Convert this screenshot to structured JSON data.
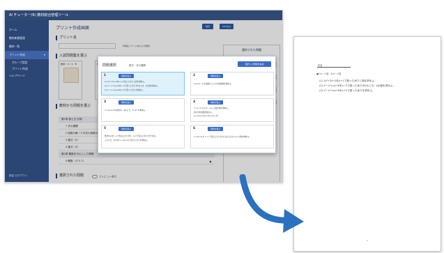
{
  "app": {
    "title": "Al チューター(R) 教材総合管理ツール",
    "sidebar": {
      "items": [
        {
          "label": "ホーム"
        },
        {
          "label": "教材新着管理"
        },
        {
          "label": "教材一覧"
        },
        {
          "label": "プリント作成",
          "active": true
        },
        {
          "label": "プリント管理"
        },
        {
          "label": "ヘルプページ"
        }
      ],
      "subitems": [
        {
          "label": "グループ設定"
        },
        {
          "label": "プリント作成"
        }
      ],
      "footer": "設定  ログアウト"
    },
    "main": {
      "title": "プリント作成画面",
      "header_buttons": [
        "保存",
        "PDF出力"
      ],
      "sections": {
        "print_name": "プリント名",
        "print_name_hint": "印刷名 1ページあたりの問題",
        "textbook": "入試問題集を選ぶ",
        "source_select": "教材から問題を選ぶ",
        "selected": "選択された問題"
      },
      "thumbnails": [
        {
          "label": "数学Ⅰ・Ａ・Ⅱ・Ｂ"
        },
        {
          "label": "数学"
        }
      ],
      "tree_rows": [
        {
          "label": "第1章  数と式 計算",
          "head": true
        },
        {
          "label": "1  式の展開"
        },
        {
          "label": "2  因数分解（２次式の因数分解）"
        },
        {
          "label": "3  整式（2）"
        },
        {
          "label": "4  整式（3）"
        },
        {
          "label": "第2章  関数を中心とした問題",
          "head": true
        },
        {
          "label": "5  関数（グラフ）"
        }
      ],
      "selected_toggle": "プレビュー表示",
      "right_panel": {
        "title": "選択された問題",
        "field1": "大問題番号",
        "field2": "小問題番号",
        "field3": "ページ",
        "field4": "配点"
      }
    },
    "modal": {
      "title": "問題選択",
      "subtitle": "数式・式の展開",
      "insert_button": "選択した問題を追加",
      "select_label": "問題を選ぶ",
      "cards": [
        {
          "num": "1",
          "selected": true,
          "lines": [
            "(1)  2x²+3x+4をx+1で割った余りと商を求めよ。",
            "(2)  x³−x²+ax+6をx−2で割った余りが0のとき、aの値を求めよ。",
            "(3)  x³−x²+ax+6をx+2で割った余りを求めよ。"
          ]
        },
        {
          "num": "2",
          "selected": false,
          "lines": [
            "a(x+b)²−6 を展開したときの定数項を求めよ。"
          ]
        },
        {
          "num": "3",
          "selected": false,
          "lines": [
            "x²+ax+b=0の解がα、βのとき、α²+β² を求めよ。"
          ]
        },
        {
          "num": "4",
          "selected": false,
          "lines": [
            "x²+y²=1 のとき、x+y の最大値を求めよ。",
            "次の式を因数分解せよ。",
            "(x+1)(x+2)(x+3)(x+4)−24"
          ]
        },
        {
          "num": "5",
          "selected": false,
          "lines": [
            "整式P(x)をx−1で割ると余りが5、x+2で割ると余りが2である。",
            "このとき、P(x)を(x−1)(x+2)で割った余りを求めよ。"
          ]
        },
        {
          "num": "6",
          "selected": false,
          "lines": [
            "x²+ax+b を x−1 で割ると余りが3になるときの a, b の値を求めよ。"
          ]
        }
      ]
    }
  },
  "document": {
    "name_label": "氏名",
    "heading": "●1ページ目・2ページ目",
    "lines": [
      "(1)  2x²+3x+4をx+1で割った余りと商を求めよ。",
      "(2)  x³−x²+ax+6をx−2で割った余りが0のとき、aの値を求めよ。",
      "(3)  x³−x²+ax+6をx+2で割った余りを求めよ。"
    ],
    "page": "1"
  },
  "colors": {
    "navy": "#2b4575",
    "accent_blue": "#2f5aa8",
    "selected_card": "#dff1fb",
    "arrow": "#2a71c0"
  }
}
